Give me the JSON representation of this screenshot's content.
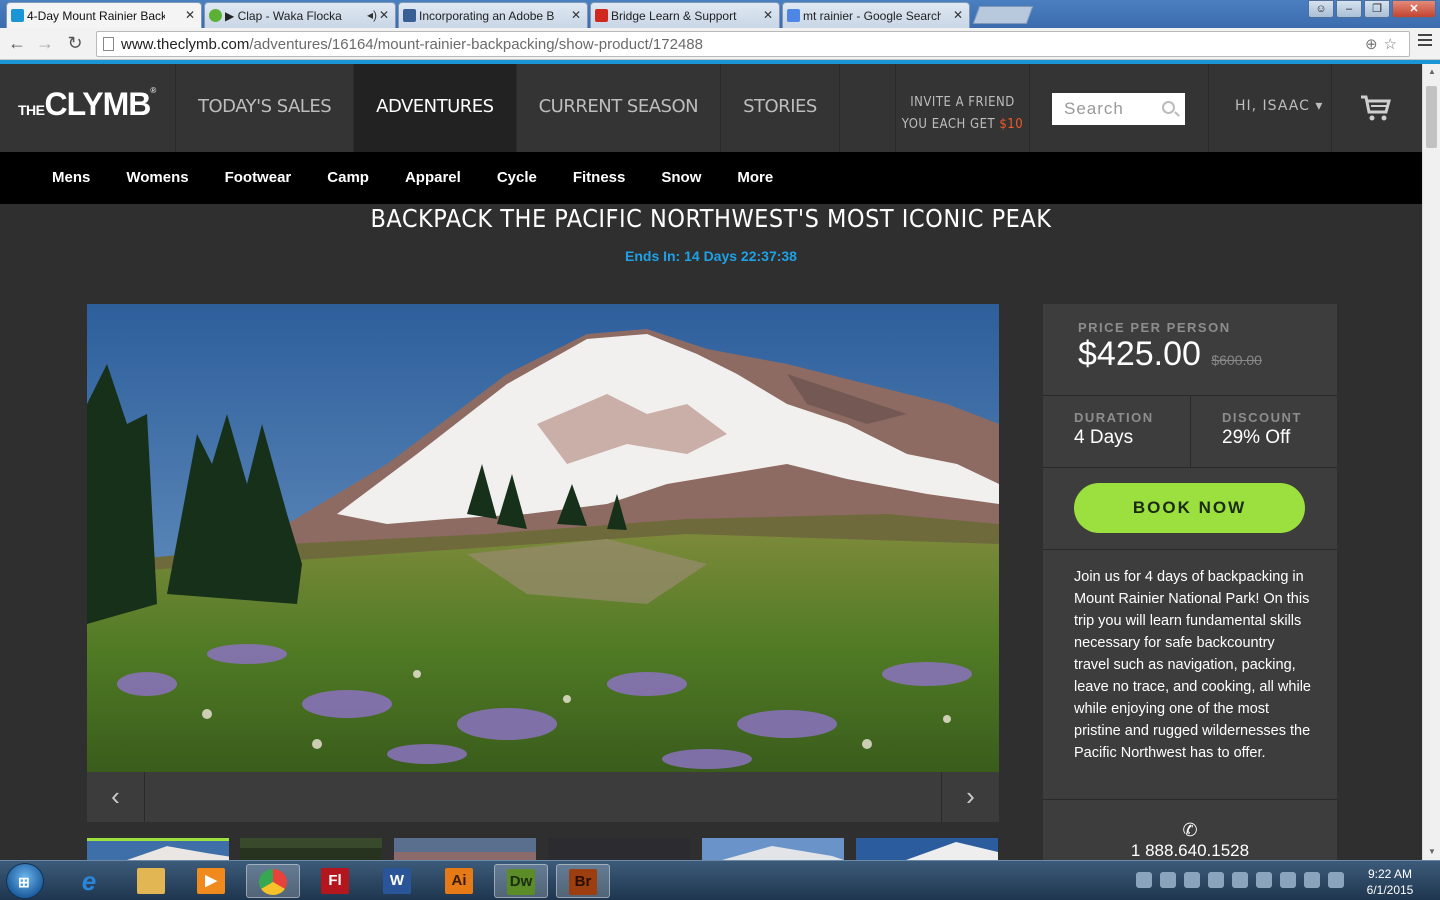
{
  "browser": {
    "tabs": [
      {
        "label": "4-Day Mount Rainier Back",
        "color": "#1a95d6",
        "active": true
      },
      {
        "label": "▶ Clap - Waka Flocka",
        "color": "#5cb135",
        "active": false
      },
      {
        "label": "Incorporating an Adobe B",
        "color": "#3a5f95",
        "active": false
      },
      {
        "label": "Bridge Learn & Support",
        "color": "#d0281e",
        "active": false
      },
      {
        "label": "mt rainier - Google Search",
        "color": "#4d86e4",
        "active": false
      }
    ],
    "url_host": "www.theclymb.com",
    "url_path": "/adventures/16164/mount-rainier-backpacking/show-product/172488"
  },
  "header": {
    "logo_the": "THE",
    "logo_clymb": "CLYMB",
    "logo_reg": "®",
    "nav": [
      "TODAY'S SALES",
      "ADVENTURES",
      "CURRENT SEASON",
      "STORIES"
    ],
    "active_nav": "ADVENTURES",
    "invite_line1": "INVITE A FRIEND",
    "invite_line2": "YOU EACH GET ",
    "invite_amount": "$10",
    "search_placeholder": "Search",
    "user_greeting": "HI, ISAAC ▾"
  },
  "categories": [
    "Mens",
    "Womens",
    "Footwear",
    "Camp",
    "Apparel",
    "Cycle",
    "Fitness",
    "Snow",
    "More"
  ],
  "product": {
    "headline": "BACKPACK THE PACIFIC NORTHWEST'S MOST ICONIC PEAK",
    "countdown": "Ends In: 14 Days 22:37:38",
    "price_label": "PRICE PER PERSON",
    "price": "$425.00",
    "old_price": "$600.00",
    "duration_label": "DURATION",
    "duration": "4 Days",
    "discount_label": "DISCOUNT",
    "discount": "29% Off",
    "book_label": "BOOK NOW",
    "description": "Join us for 4 days of backpacking in Mount Rainier National Park! On this trip you will learn fundamental skills necessary for safe backcountry travel such as navigation, packing, leave no trace, and cooking, all while while enjoying one of the most pristine and rugged wildernesses the Pacific Northwest has to offer.",
    "phone": "1 888.640.1528",
    "accent_green": "#9be03e",
    "accent_blue": "#1ea1e6",
    "accent_orange": "#f05a28"
  },
  "taskbar": {
    "apps": [
      {
        "icon": "internet-explorer-icon",
        "label": "e",
        "color": "#2a84d8"
      },
      {
        "icon": "file-explorer-icon",
        "label": "",
        "color": "#e2b652"
      },
      {
        "icon": "media-player-icon",
        "label": "▶",
        "color": "#f08a1c"
      },
      {
        "icon": "chrome-icon",
        "label": "",
        "color": "#e8423a",
        "active": true
      },
      {
        "icon": "flash-icon",
        "label": "Fl",
        "color": "#b3161c"
      },
      {
        "icon": "word-icon",
        "label": "W",
        "color": "#2a5699"
      },
      {
        "icon": "illustrator-icon",
        "label": "Ai",
        "color": "#e57a16"
      },
      {
        "icon": "dreamweaver-icon",
        "label": "Dw",
        "color": "#5c8c28"
      },
      {
        "icon": "bridge-icon",
        "label": "Br",
        "color": "#9c3e10"
      }
    ],
    "time": "9:22 AM",
    "date": "6/1/2015"
  }
}
